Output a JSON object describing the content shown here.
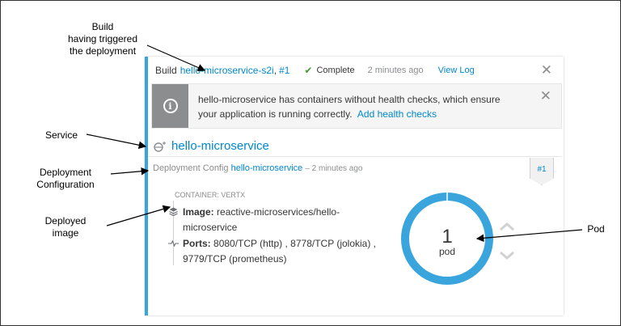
{
  "callouts": {
    "build": [
      "Build",
      "having triggered",
      "the deployment"
    ],
    "service": "Service",
    "deployment": [
      "Deployment",
      "Configuration"
    ],
    "image": [
      "Deployed",
      "image"
    ],
    "pod": "Pod"
  },
  "build": {
    "label": "Build",
    "name": "hello-microservice-s2i",
    "separator": ",",
    "number": "#1",
    "status": "Complete",
    "time": "2 minutes ago",
    "view_log": "View Log"
  },
  "warning": {
    "message": "hello-microservice has containers without health checks, which ensure your application is running correctly.",
    "action": "Add health checks"
  },
  "service": {
    "name": "hello-microservice"
  },
  "deployment": {
    "label": "Deployment Config",
    "name": "hello-microservice",
    "time": "– 2 minutes ago",
    "badge": "#1"
  },
  "container": {
    "label": "CONTAINER: VERTX",
    "image_label": "Image:",
    "image_value": "reactive-microservices/hello-microservice",
    "ports_label": "Ports:",
    "ports_value": "8080/TCP (http) , 8778/TCP (jolokia) , 9779/TCP (prometheus)"
  },
  "pods": {
    "count": "1",
    "unit": "pod"
  },
  "colors": {
    "accent": "#39a5dc",
    "link": "#0088ce",
    "success": "#3f9c35",
    "donut": "#39a5dc"
  }
}
